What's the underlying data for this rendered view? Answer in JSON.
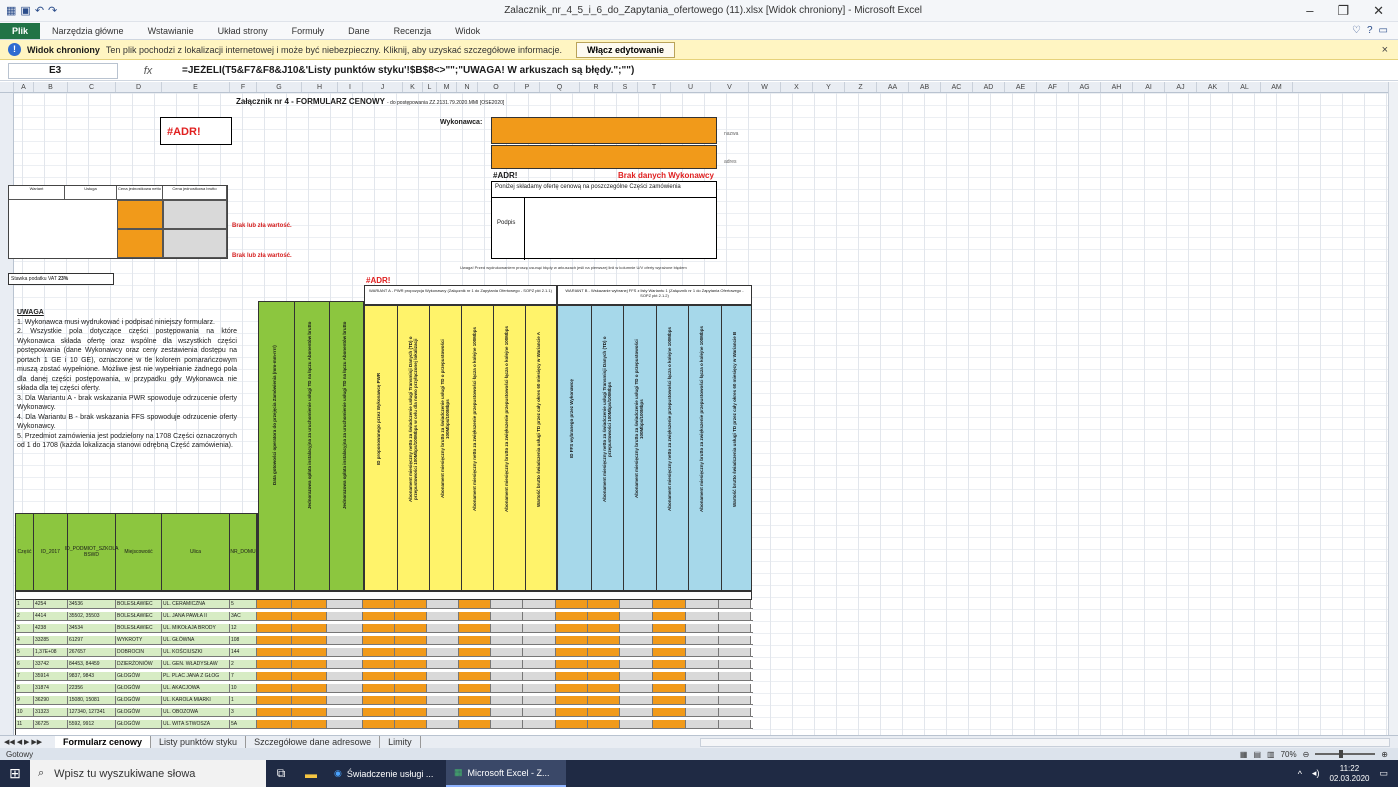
{
  "window": {
    "title": "Zalacznik_nr_4_5_i_6_do_Zapytania_ofertowego (11).xlsx [Widok chroniony] - Microsoft Excel",
    "minimize": "–",
    "maximize": "❐",
    "close": "✕"
  },
  "ribbon": {
    "tabs": [
      "Plik",
      "Narzędzia główne",
      "Wstawianie",
      "Układ strony",
      "Formuły",
      "Dane",
      "Recenzja",
      "Widok"
    ]
  },
  "protected_view": {
    "title": "Widok chroniony",
    "message": "Ten plik pochodzi z lokalizacji internetowej i może być niebezpieczny. Kliknij, aby uzyskać szczegółowe informacje.",
    "button": "Włącz edytowanie",
    "close": "×"
  },
  "formula_bar": {
    "cell": "E3",
    "fx": "fx",
    "formula": "=JEŻELI(T5&F7&F8&J10&'Listy punktów styku'!$B$8<>\"\";\"UWAGA! W arkuszach są błędy.\";\"\")"
  },
  "columns": [
    "A",
    "B",
    "C",
    "D",
    "E",
    "F",
    "G",
    "H",
    "I",
    "J",
    "K",
    "L",
    "M",
    "N",
    "O",
    "P",
    "Q",
    "R",
    "S",
    "T",
    "U",
    "V",
    "W",
    "X",
    "Y",
    "Z",
    "AA",
    "AB",
    "AC",
    "AD",
    "AE",
    "AF",
    "AG",
    "AH",
    "AI",
    "AJ",
    "AK",
    "AL",
    "AM"
  ],
  "sheet": {
    "title": "Załącznik nr 4 - FORMULARZ CENOWY",
    "title_small": "- do postępowania ZZ.2131.79.2020.MMI [OSE2020]",
    "adr_main": "#ADR!",
    "wykonawca_label": "Wykonawca:",
    "nazwa_note": "nazwa",
    "adres_note": "adres",
    "adr_second": "#ADR!",
    "no_data": "Brak danych Wykonawcy",
    "offer_line": "Poniżej składamy ofertę cenową na poszczególne Części zamówienia",
    "podpis": "Podpis",
    "variant_headers": [
      "Wariant",
      "Usługa",
      "Cena jednostkowa netto",
      "Cena jednostkowa brutto"
    ],
    "brak1": "Brak lub zła wartość.",
    "brak2": "Brak lub zła wartość.",
    "vat_label": "Stawka podatku VAT",
    "vat_value": "23%",
    "adr_third": "#ADR!",
    "variant_a": "WARIANT A - PWR propozycja Wykonawcy (Załącznik nr 1 do Zapytania Ofertowego - SOPZ pkt 2.1.1)",
    "variant_b": "WARIANT B - Wskazanie wybranej FFS z listy Wariantu 1 (Załącznik nr 1 do Zapytania Ofertowego - SOPZ pkt 2.1.2)",
    "uwaga_title": "UWAGA",
    "uwaga_points": [
      "1. Wykonawca musi wydrukować i podpisać niniejszy formularz.",
      "2. Wszystkie pola dotyczące części postępowania na które Wykonawca składa ofertę oraz wspólne dla wszystkich części postępowania (dane Wykonawcy oraz ceny zestawienia dostępu na portach 1 GE i 10 GE), oznaczone w tle kolorem pomarańczowym muszą zostać wypełnione. Możliwe jest nie wypełnianie żadnego pola dla danej części postępowania, w przypadku gdy Wykonawca nie składa dla tej części oferty.",
      "3. Dla Wariantu A - brak wskazania PWR spowoduje odrzucenie oferty Wykonawcy.",
      "4. Dla Wariantu B - brak wskazania FFS spowoduje odrzucenie oferty Wykonawcy.",
      "5. Przedmiot zamówienia jest podzielony na 1708 Części oznaczonych od 1 do 1708 (każda lokalizacja stanowi odrębną Część zamówienia)."
    ],
    "small_note": "Uwaga! Przed wydrukowaniem proszę usunąć błędy w arkuszach jeśli na pierwszej linii w kolumnie U/V oferty wyrażone błędem",
    "green_headers": [
      "Data gotowości operatora do przejęcia Zamówienia (mm-mm-rrrr)",
      "Jednorazowa opłata instalacyjna za uruchomienie usługi TD na łączu Abonentów brutto",
      "Jednorazowa opłata instalacyjna za uruchomienie usługi TD na łączu Abonentów brutto"
    ],
    "yellow_headers": [
      "ID proponowanego przez Wykonawcę PWR",
      "Abonament miesięczny netto za świadczenie usługi Transmisji Danych (TD) o przepustowości 100Mbps/100Mbps w celu dla nowo przyłączonej lokalizacji",
      "Abonament miesięczny brutto za świadczenie usługi TD o przepustowości 100Mbps/100Mbps",
      "Abonament miesięczny netto za zwiększenie przepustowości łącza o kolejne 100Mbps",
      "Abonament miesięczny brutto za zwiększenie przepustowości łącza o kolejne 100Mbps",
      "Wartość brutto świadczenia usługi TD przez cały okres 60 miesięcy w Wariancie A"
    ],
    "blue_headers": [
      "ID FFS wybranego przez Wykonawcę",
      "Abonament miesięczny netto za świadczenie usługi Transmisji Danych (TD) o przepustowości 100Mbps/100Mbps",
      "Abonament miesięczny brutto za świadczenie usługi TD o przepustowości 100Mbps/100Mbps",
      "Abonament miesięczny netto za zwiększenie przepustowości łącza o kolejne 100Mbps",
      "Abonament miesięczny brutto za zwiększenie przepustowości łącza o kolejne 100Mbps",
      "Wartość brutto świadczenia usługi TD przez cały okres 60 miesięcy w Wariancie B"
    ],
    "data_headers": [
      "Część",
      "ID_2017",
      "ID_PODMIOT_SZKOLA BSWD",
      "Miejscowość",
      "Ulica",
      "NR_DOMU"
    ],
    "rows": [
      [
        "1",
        "4254",
        "34536",
        "BOLESŁAWIEC",
        "UL. CERAMICZNA",
        "5"
      ],
      [
        "2",
        "4414",
        "35502, 35503",
        "BOLESŁAWIEC",
        "UL. JANA PAWŁA II",
        "3AC"
      ],
      [
        "3",
        "4238",
        "34534",
        "BOLESŁAWIEC",
        "UL. MIKOŁAJA BRODY",
        "12"
      ],
      [
        "4",
        "33285",
        "61297",
        "WYKROTY",
        "UL. GŁÓWNA",
        "108"
      ],
      [
        "5",
        "1,37E+08",
        "267657",
        "DOBROCIN",
        "UL. KOŚCIUSZKI",
        "144"
      ],
      [
        "6",
        "33742",
        "84453, 84459",
        "DZIERŻONIÓW",
        "UL. GEN. WŁADYSŁAW",
        "2"
      ],
      [
        "7",
        "35914",
        "9837, 9843",
        "GŁOGÓW",
        "PL. PLAC JANA Z GŁOG",
        "7"
      ],
      [
        "8",
        "31874",
        "22356",
        "GŁOGÓW",
        "UL. AKACJOWA",
        "10"
      ],
      [
        "9",
        "36290",
        "15080, 15081",
        "GŁOGÓW",
        "UL. KAROLA MIARKI",
        "1"
      ],
      [
        "10",
        "31323",
        "127340, 127341",
        "GŁOGÓW",
        "UL. OBOZOWA",
        "3"
      ],
      [
        "11",
        "36725",
        "5592, 9912",
        "GŁOGÓW",
        "UL. WITA STWOSZA",
        "5A"
      ]
    ]
  },
  "sheet_tabs": [
    "Formularz cenowy",
    "Listy punktów styku",
    "Szczegółowe dane adresowe",
    "Limity"
  ],
  "status": {
    "ready": "Gotowy",
    "zoom": "70%"
  },
  "taskbar": {
    "search": "Wpisz tu wyszukiwane słowa",
    "app1": "Świadczenie usługi ...",
    "app2": "Microsoft Excel - Z...",
    "time": "11:22",
    "date": "02.03.2020"
  },
  "colors": {
    "orange": "#f19a1a",
    "green": "#8cc63f",
    "yellow": "#fff36a",
    "blue": "#a6d8ea",
    "error": "#e02020"
  }
}
